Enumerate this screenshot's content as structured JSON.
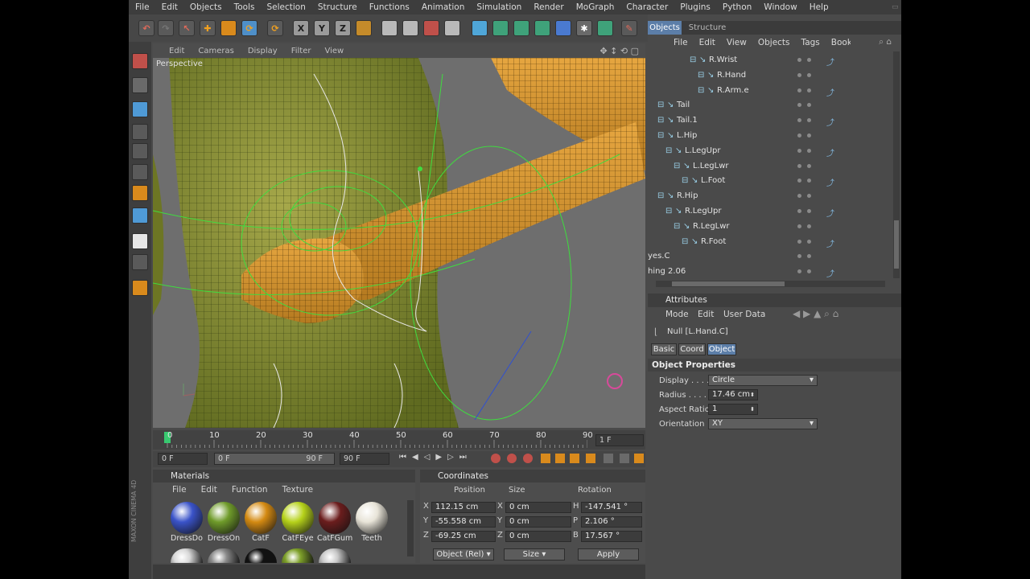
{
  "menubar": {
    "items": [
      "File",
      "Edit",
      "Objects",
      "Tools",
      "Selection",
      "Structure",
      "Functions",
      "Animation",
      "Simulation",
      "Render",
      "MoGraph",
      "Character",
      "Plugins",
      "Python",
      "Window",
      "Help"
    ]
  },
  "toolbar": {
    "axis_x": "X",
    "axis_y": "Y",
    "axis_z": "Z"
  },
  "viewport": {
    "menu": [
      "Edit",
      "Cameras",
      "Display",
      "Filter",
      "View"
    ],
    "label": "Perspective"
  },
  "timeline": {
    "ticks": [
      "0",
      "10",
      "20",
      "30",
      "40",
      "50",
      "60",
      "70",
      "80",
      "90"
    ],
    "current_frame": "1 F",
    "start_field": "0 F",
    "range_start": "0 F",
    "range_end": "90 F",
    "end_field": "90 F"
  },
  "materials": {
    "title": "Materials",
    "menu": [
      "File",
      "Edit",
      "Function",
      "Texture"
    ],
    "items": [
      {
        "label": "DressDo",
        "color": "#3a53c9"
      },
      {
        "label": "DressOn",
        "color": "#6f9b2a"
      },
      {
        "label": "CatF",
        "color": "#d48a12"
      },
      {
        "label": "CatFEye",
        "color": "#b6d21a"
      },
      {
        "label": "CatFGum",
        "color": "#6b1d1d"
      },
      {
        "label": "Teeth",
        "color": "#e8e4d8"
      }
    ],
    "row2_colors": [
      "#d8d8d8",
      "#8a8a8a",
      "#111111",
      "#7ea02a",
      "#c8c8c8"
    ]
  },
  "coordinates": {
    "title": "Coordinates",
    "col_position": "Position",
    "col_size": "Size",
    "col_rotation": "Rotation",
    "rows": [
      {
        "axis": "X",
        "pos": "112.15 cm",
        "saxis": "X",
        "size": "0 cm",
        "raxis": "H",
        "rot": "-147.541 °"
      },
      {
        "axis": "Y",
        "pos": "-55.558 cm",
        "saxis": "Y",
        "size": "0 cm",
        "raxis": "P",
        "rot": "2.106 °"
      },
      {
        "axis": "Z",
        "pos": "-69.25 cm",
        "saxis": "Z",
        "size": "0 cm",
        "raxis": "B",
        "rot": "17.567 °"
      }
    ],
    "mode_dropdown": "Object (Rel)",
    "size_dropdown": "Size",
    "apply": "Apply"
  },
  "object_manager": {
    "tabs": [
      "Objects",
      "Structure"
    ],
    "menu": [
      "File",
      "Edit",
      "View",
      "Objects",
      "Tags",
      "Bookmarks"
    ],
    "rows": [
      {
        "label": "R.Wrist",
        "indent": 5
      },
      {
        "label": "R.Hand",
        "indent": 6
      },
      {
        "label": "R.Arm.e",
        "indent": 6
      },
      {
        "label": "Tail",
        "indent": 1
      },
      {
        "label": "Tail.1",
        "indent": 1
      },
      {
        "label": "L.Hip",
        "indent": 1
      },
      {
        "label": "L.LegUpr",
        "indent": 2
      },
      {
        "label": "L.LegLwr",
        "indent": 3
      },
      {
        "label": "L.Foot",
        "indent": 4
      },
      {
        "label": "R.Hip",
        "indent": 1
      },
      {
        "label": "R.LegUpr",
        "indent": 2
      },
      {
        "label": "R.LegLwr",
        "indent": 3
      },
      {
        "label": "R.Foot",
        "indent": 4
      },
      {
        "label": "yes.C",
        "indent": 0
      },
      {
        "label": "hing 2.06",
        "indent": 0
      }
    ]
  },
  "attributes": {
    "title": "Attributes",
    "menu": [
      "Mode",
      "Edit",
      "User Data"
    ],
    "object_name": "Null [L.Hand.C]",
    "tabs": [
      "Basic",
      "Coord",
      "Object"
    ],
    "active_tab": "Object",
    "section": "Object Properties",
    "display_label": "Display . . . .",
    "display_value": "Circle",
    "radius_label": "Radius . . . . .",
    "radius_value": "17.46 cm",
    "aspect_label": "Aspect Ratio",
    "aspect_value": "1",
    "orientation_label": "Orientation",
    "orientation_value": "XY"
  },
  "brand": "MAXON CINEMA 4D"
}
